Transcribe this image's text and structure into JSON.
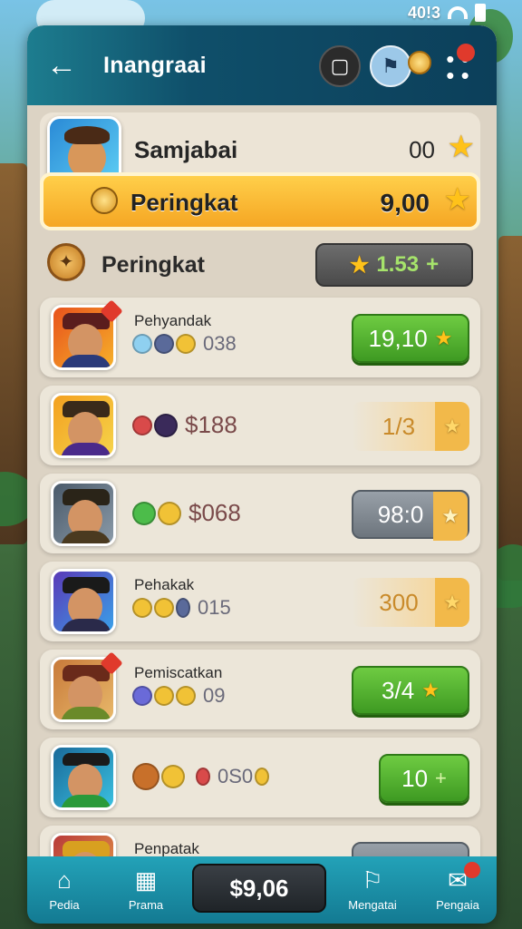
{
  "status_bar": {
    "time": "40!3"
  },
  "header": {
    "title": "Inangraai"
  },
  "profile": {
    "name": "Samjabai",
    "score": "00",
    "rank_label": "Peringkat",
    "rank_score": "9,00"
  },
  "section": {
    "title": "Peringkat",
    "total": "1.53"
  },
  "rows": [
    {
      "name": "Pehyandak",
      "amount": "038",
      "score": "19,10",
      "style": "green"
    },
    {
      "name": "",
      "amount": "$188",
      "score": "1/3",
      "style": "pale"
    },
    {
      "name": "",
      "amount": "$068",
      "score": "98:0",
      "style": "gray"
    },
    {
      "name": "Pehakak",
      "amount": "015",
      "score": "300",
      "style": "pale"
    },
    {
      "name": "Pemiscatkan",
      "amount": "09",
      "score": "3/4",
      "style": "green"
    },
    {
      "name": "",
      "amount": "0S0",
      "score": "10",
      "style": "green-plus"
    },
    {
      "name": "Penpatak",
      "amount": "",
      "score": "",
      "style": "gray"
    }
  ],
  "nav": {
    "items": [
      {
        "label": "Pedia"
      },
      {
        "label": "Prama"
      },
      {
        "label": "Mengatai"
      },
      {
        "label": "Pengaia"
      }
    ],
    "center_value": "$9,06"
  },
  "colors": {
    "header": "#0f4f6a",
    "gold": "#f5a623",
    "green": "#3e9a22",
    "nav": "#137a92"
  }
}
